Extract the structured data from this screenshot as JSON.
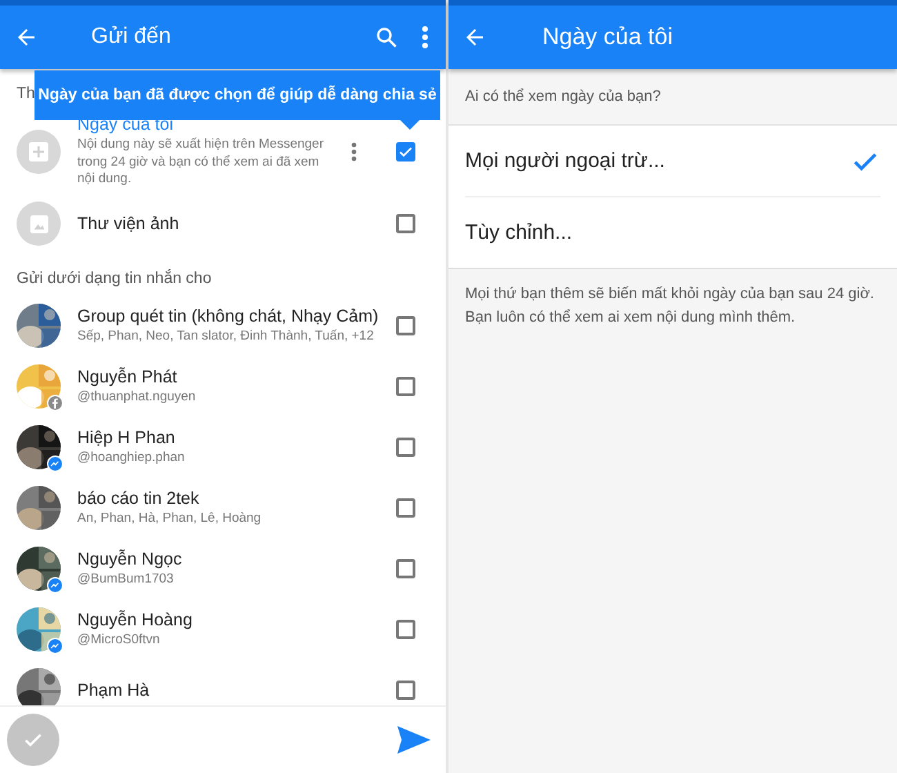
{
  "send_screen": {
    "title": "Gửi đến",
    "tooltip": "Ngày của bạn đã được chọn để giúp dễ dàng chia sẻ",
    "top_section": "Th",
    "top_items": [
      {
        "kind": "story",
        "title": "Ngày của tôi",
        "description": "Nội dung này sẽ xuất hiện trên Messenger trong 24 giờ và bạn có thể xem ai đã xem nội dung.",
        "checked": true
      },
      {
        "kind": "gallery",
        "title": "Thư viện ảnh",
        "checked": false
      }
    ],
    "contacts_section": "Gửi dưới dạng tin nhắn cho",
    "contacts": [
      {
        "name": "Group quét tin (không chát, Nhạy Cảm)",
        "subtitle": "Sếp, Phan, Neo, Tan slator, Đinh Thành, Tuấn, +12",
        "kind": "plain",
        "checked": false
      },
      {
        "name": "Nguyễn Phát",
        "subtitle": "@thuanphat.nguyen",
        "kind": "social",
        "checked": false
      },
      {
        "name": "Hiệp H Phan",
        "subtitle": "@hoanghiep.phan",
        "kind": "chat",
        "checked": false
      },
      {
        "name": "báo cáo tin 2tek",
        "subtitle": "An, Phan, Hà, Phan, Lê, Hoàng",
        "kind": "plain",
        "checked": false
      },
      {
        "name": "Nguyễn Ngọc",
        "subtitle": "@BumBum1703",
        "kind": "chat",
        "checked": false
      },
      {
        "name": "Nguyễn Hoàng",
        "subtitle": "@MicroS0ftvn",
        "kind": "chat",
        "checked": false
      },
      {
        "name": "Phạm Hà",
        "kind": "plain",
        "checked": false
      }
    ]
  },
  "my_day_screen": {
    "title": "Ngày của tôi",
    "question": "Ai có thể xem ngày của bạn?",
    "options": [
      {
        "label": "Mọi người ngoại trừ...",
        "selected": true
      },
      {
        "label": "Tùy chỉnh...",
        "selected": false
      }
    ],
    "note": "Mọi thứ bạn thêm sẽ biến mất khỏi ngày của bạn sau 24 giờ. Bạn luôn có thể xem ai xem nội dung mình thêm."
  }
}
